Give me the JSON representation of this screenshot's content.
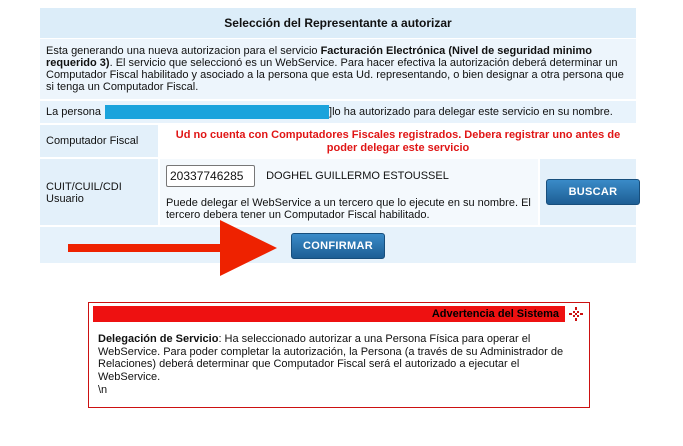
{
  "panel": {
    "title": "Selección del Representante a autorizar",
    "desc_intro": "Esta generando una nueva autorizacion para el servicio ",
    "desc_service": "Facturación Electrónica (Nivel de seguridad minimo requerido 3)",
    "desc_rest": ". El servicio que seleccionó es un WebService. Para hacer efectiva la autorización deberá determinar un Computador Fiscal habilitado y asociado a la persona que esta Ud. representando, o bien designar a otra persona que si tenga un Computador Fiscal.",
    "persona_prefix": "La persona",
    "persona_suffix": "]lo ha autorizado para delegar este servicio en su nombre.",
    "computador_label": "Computador Fiscal",
    "computador_msg": "Ud no cuenta con Computadores Fiscales registrados. Debera registrar uno antes de poder delegar este servicio",
    "cuit_label_1": "CUIT/CUIL/CDI",
    "cuit_label_2": "Usuario",
    "cuit_value": "20337746285",
    "cuit_name": "DOGHEL GUILLERMO ESTOUSSEL",
    "cuit_note": "Puede delegar el WebService a un tercero que lo ejecute en su nombre. El tercero debera tener un Computador Fiscal habilitado.",
    "buscar_label": "BUSCAR",
    "confirmar_label": "CONFIRMAR"
  },
  "warning": {
    "header": "Advertencia del Sistema",
    "bold_lead": "Delegación de Servicio",
    "body": ": Ha seleccionado autorizar a una Persona Física para operar el WebService. Para poder completar la autorización, la Persona (a través de su Administrador de Relaciones) deberá determinar que Computador Fiscal será el autorizado a ejecutar el WebService.",
    "trailer": "\\n"
  },
  "colors": {
    "accent_blue": "#1ba3dc",
    "error_red": "#e01515",
    "warning_red": "#ee1111",
    "arrow_red": "#ee2200"
  }
}
